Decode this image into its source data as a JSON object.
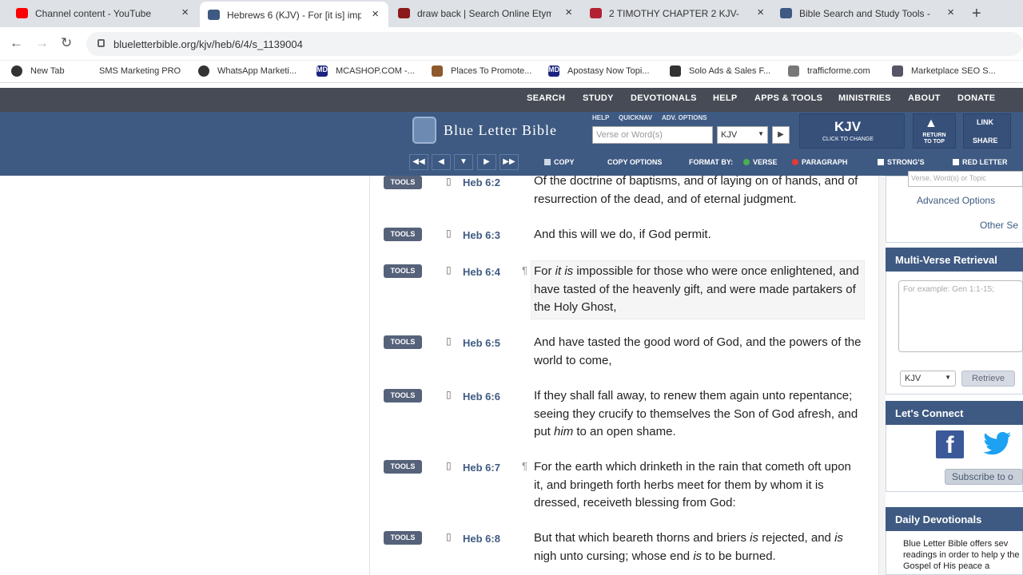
{
  "browser": {
    "tabs": [
      {
        "title": "Channel content - YouTube Studio",
        "color": "#ff0000"
      },
      {
        "title": "Hebrews 6 (KJV) - For [it is] imp",
        "color": "#3e5a82"
      },
      {
        "title": "draw back | Search Online Etym",
        "color": "#8b1a1a"
      },
      {
        "title": "2 TIMOTHY CHAPTER 2 KJV-",
        "color": "#b22234"
      },
      {
        "title": "Bible Search and Study Tools - B",
        "color": "#3e5a82"
      }
    ],
    "url": "blueletterbible.org/kjv/heb/6/4/s_1139004",
    "bookmarks": [
      "New Tab",
      "SMS Marketing PRO",
      "WhatsApp Marketi...",
      "MCASHOP.COM -...",
      "Places To Promote...",
      "Apostasy Now Topi...",
      "Solo Ads & Sales F...",
      "trafficforme.com",
      "Marketplace SEO S..."
    ],
    "bookmark_icons": [
      "globe-icon",
      "sms-icon",
      "globe-icon",
      "md-icon",
      "store-icon",
      "md-icon",
      "car-icon",
      "traffic-icon",
      "marketplace-icon"
    ]
  },
  "site": {
    "nav": [
      "SEARCH",
      "STUDY",
      "DEVOTIONALS",
      "HELP",
      "APPS & TOOLS",
      "MINISTRIES",
      "ABOUT",
      "DONATE"
    ],
    "logo_text": "Blue Letter Bible",
    "help_links": [
      "HELP",
      "QUICKNAV",
      "ADV. OPTIONS"
    ],
    "search_placeholder": "Verse or Word(s)",
    "version": "KJV",
    "version_big": "KJV",
    "version_sub": "CLICK TO CHANGE",
    "return_label": "RETURN TO TOP",
    "link_label": "LINK",
    "share_label": "SHARE",
    "toolbar": {
      "copy": "COPY",
      "copy_options": "COPY OPTIONS",
      "format_by": "FORMAT BY:",
      "verse": "VERSE",
      "paragraph": "PARAGRAPH",
      "strongs": "STRONG'S",
      "red_letter": "RED LETTER"
    },
    "accent": "#3e5a82"
  },
  "verses": [
    {
      "ref": "Heb 6:2",
      "tools": "TOOLS",
      "para": "",
      "text": "Of the doctrine of baptisms, and of laying on of hands, and of resurrection of the dead, and of eternal judgment."
    },
    {
      "ref": "Heb 6:3",
      "tools": "TOOLS",
      "para": "",
      "text": "And this will we do, if God permit."
    },
    {
      "ref": "Heb 6:4",
      "tools": "TOOLS",
      "para": "¶",
      "text_a": "For ",
      "text_it": "it is",
      "text_b": " impossible for those who were once enlightened, and have tasted of the heavenly gift, and were made partakers of the Holy Ghost,"
    },
    {
      "ref": "Heb 6:5",
      "tools": "TOOLS",
      "para": "",
      "text": "And have tasted the good word of God, and the powers of the world to come,"
    },
    {
      "ref": "Heb 6:6",
      "tools": "TOOLS",
      "para": "",
      "text_a": "If they shall fall away, to renew them again unto repentance; seeing they crucify to themselves the Son of God afresh, and put ",
      "text_it": "him",
      "text_b": " to an open shame."
    },
    {
      "ref": "Heb 6:7",
      "tools": "TOOLS",
      "para": "¶",
      "text": "For the earth which drinketh in the rain that cometh oft upon it, and bringeth forth herbs meet for them by whom it is dressed, receiveth blessing from God:"
    },
    {
      "ref": "Heb 6:8",
      "tools": "TOOLS",
      "para": "",
      "text_a": "But that which beareth thorns and briers ",
      "text_it": "is",
      "text_b": " rejected, and ",
      "text_it2": "is",
      "text_c": " nigh unto cursing; whose end ",
      "text_it3": "is",
      "text_d": " to be burned."
    }
  ],
  "sidebar": {
    "search_placeholder": "Verse, Word(s) or Topic",
    "advanced": "Advanced Options",
    "other": "Other Se",
    "mvr_title": "Multi-Verse Retrieval",
    "mvr_placeholder": "For example: Gen 1:1-15;",
    "mvr_version": "KJV",
    "retrieve": "Retrieve",
    "connect_title": "Let's Connect",
    "subscribe": "Subscribe to o",
    "devotionals_title": "Daily Devotionals",
    "devotionals_text": "Blue Letter Bible offers sev readings in order to help y the Gospel of His peace a"
  }
}
